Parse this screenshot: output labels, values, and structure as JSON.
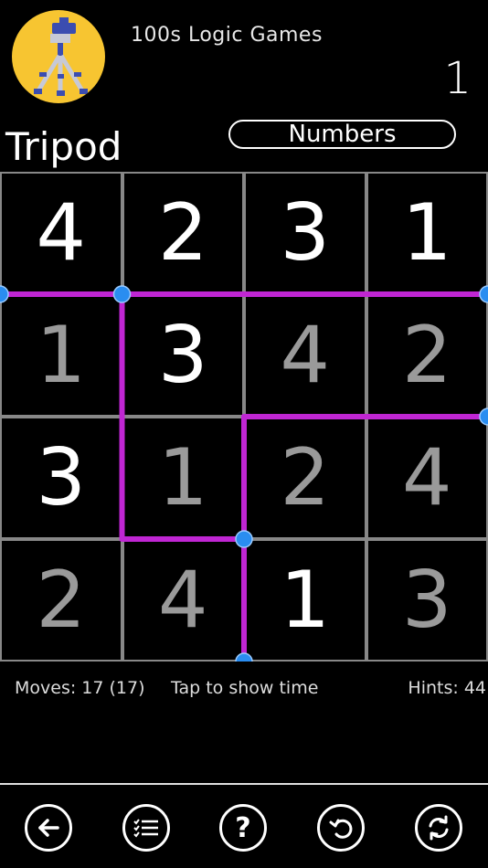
{
  "header": {
    "app_title": "100s Logic Games",
    "level_number": "1",
    "logo_icon": "tripod-icon"
  },
  "game": {
    "title": "Tripod",
    "mode_label": "Numbers"
  },
  "grid": {
    "rows": 4,
    "cols": 4,
    "cells": [
      [
        {
          "v": "4",
          "given": true
        },
        {
          "v": "2",
          "given": true
        },
        {
          "v": "3",
          "given": true
        },
        {
          "v": "1",
          "given": true
        }
      ],
      [
        {
          "v": "1",
          "given": false
        },
        {
          "v": "3",
          "given": true
        },
        {
          "v": "4",
          "given": false
        },
        {
          "v": "2",
          "given": false
        }
      ],
      [
        {
          "v": "3",
          "given": true
        },
        {
          "v": "1",
          "given": false
        },
        {
          "v": "2",
          "given": false
        },
        {
          "v": "4",
          "given": false
        }
      ],
      [
        {
          "v": "2",
          "given": false
        },
        {
          "v": "4",
          "given": false
        },
        {
          "v": "1",
          "given": true
        },
        {
          "v": "3",
          "given": false
        }
      ]
    ],
    "line_color": "#c026d3",
    "node_color": "#2a8df0",
    "given_color": "#ffffff",
    "entered_color": "#9a9a9a"
  },
  "status": {
    "moves": "Moves: 17 (17)",
    "timer_prompt": "Tap to show time",
    "hints": "Hints: 44"
  },
  "nav": [
    {
      "name": "back-button",
      "icon": "arrow-left-icon"
    },
    {
      "name": "list-button",
      "icon": "checklist-icon"
    },
    {
      "name": "help-button",
      "icon": "question-icon"
    },
    {
      "name": "undo-button",
      "icon": "undo-icon"
    },
    {
      "name": "restart-button",
      "icon": "refresh-icon"
    }
  ]
}
